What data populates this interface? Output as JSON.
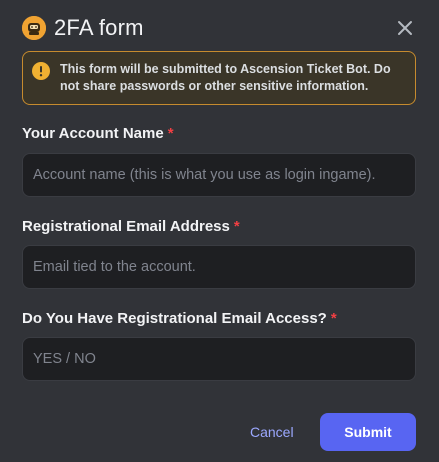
{
  "modal": {
    "title": "2FA form",
    "close_icon": "close-icon",
    "bot_avatar_icon": "bot-avatar-icon"
  },
  "notice": {
    "icon": "warning-icon",
    "text": "This form will be submitted to Ascension Ticket Bot. Do not share passwords or other sensitive information."
  },
  "fields": [
    {
      "label": "Your Account Name",
      "required_marker": "*",
      "placeholder": "Account name (this is what you use as login ingame).",
      "value": ""
    },
    {
      "label": "Registrational Email Address",
      "required_marker": "*",
      "placeholder": "Email tied to the account.",
      "value": ""
    },
    {
      "label": "Do You Have Registrational Email Access?",
      "required_marker": "*",
      "placeholder": "YES / NO",
      "value": ""
    }
  ],
  "actions": {
    "cancel_label": "Cancel",
    "submit_label": "Submit"
  },
  "colors": {
    "background": "#313338",
    "notice_border": "#c68b2e",
    "notice_icon": "#f0b132",
    "required": "#f23f43",
    "primary_button": "#5865f2",
    "cancel_link": "#9ba8ff"
  }
}
